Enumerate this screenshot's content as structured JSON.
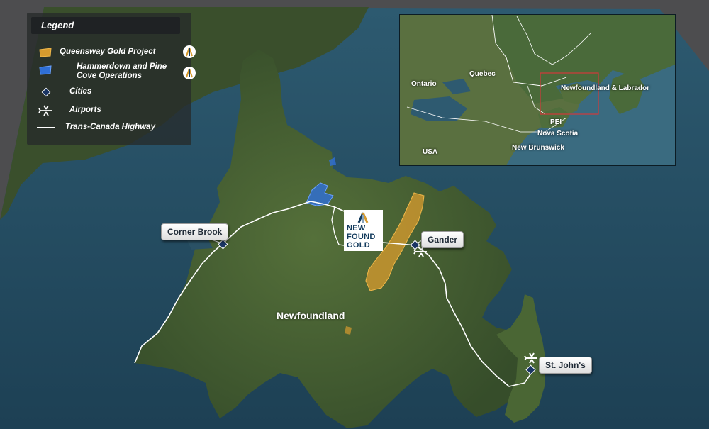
{
  "legend": {
    "title": "Legend",
    "items": [
      {
        "label": "Queensway Gold Project",
        "symbol": "gold-area-swatch",
        "color": "#d59a2e"
      },
      {
        "label": "Hammerdown and Pine Cove Operations",
        "symbol": "blue-area-swatch",
        "color": "#2f6fd6"
      },
      {
        "label": "Cities",
        "symbol": "diamond",
        "color": "#1a3563"
      },
      {
        "label": "Airports",
        "symbol": "airplane-icon",
        "color": "#ffffff"
      },
      {
        "label": "Trans-Canada Highway",
        "symbol": "white-line",
        "color": "#ffffff"
      }
    ]
  },
  "cities": [
    {
      "name": "Corner Brook"
    },
    {
      "name": "Gander"
    },
    {
      "name": "St. John's"
    }
  ],
  "region": {
    "name": "Newfoundland"
  },
  "logo": {
    "line1": "NEW",
    "line2": "FOUND",
    "line3": "GOLD"
  },
  "inset": {
    "labels": [
      "Ontario",
      "Quebec",
      "Newfoundland & Labrador",
      "PEI",
      "Nova Scotia",
      "New Brunswick",
      "USA"
    ]
  },
  "colors": {
    "ocean": "#244a60",
    "land": "#3f5a2f",
    "gold_project": "#d59a2e",
    "operations": "#2f6fd6",
    "city_marker": "#1a3563",
    "inset_frame": "#d23a3a"
  }
}
